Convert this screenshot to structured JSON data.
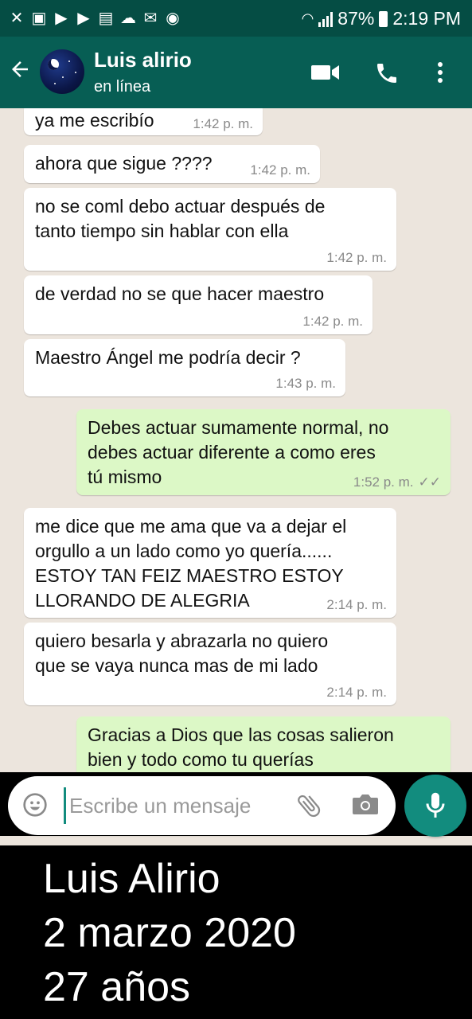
{
  "status_bar": {
    "battery": "87%",
    "time": "2:19 PM"
  },
  "header": {
    "contact_name": "Luis alirio",
    "contact_status": "en línea"
  },
  "messages": [
    {
      "text": "ya me escribío",
      "time": "1:42 p. m.",
      "direction": "in"
    },
    {
      "text": "ahora que sigue ????",
      "time": "1:42 p. m.",
      "direction": "in"
    },
    {
      "text": "no se coml debo actuar después de\ntanto tiempo sin hablar con ella",
      "time": "1:42 p. m.",
      "direction": "in"
    },
    {
      "text": "de verdad no se que hacer maestro",
      "time": "1:42 p. m.",
      "direction": "in"
    },
    {
      "text": "Maestro Ángel me podría decir ?",
      "time": "1:43 p. m.",
      "direction": "in"
    },
    {
      "text": "Debes actuar sumamente normal, no\ndebes actuar diferente a como eres\ntú mismo",
      "time": "1:52 p. m.",
      "direction": "out"
    },
    {
      "text": "me dice que me ama que va a dejar el\norgullo a un lado como yo quería......\nESTOY TAN FEIZ MAESTRO ESTOY\nLLORANDO DE ALEGRIA",
      "time": "2:14 p. m.",
      "direction": "in"
    },
    {
      "text": "quiero besarla y abrazarla no quiero\nque se vaya nunca mas de mi lado",
      "time": "2:14 p. m.",
      "direction": "in"
    },
    {
      "text": "Gracias a Dios que las cosas salieron\nbien y todo como tu querías",
      "time": "",
      "direction": "out"
    }
  ],
  "composer": {
    "placeholder": "Escribe un mensaje"
  },
  "caption": {
    "line1": "Luis Alirio",
    "line2": "2 marzo 2020",
    "line3": "27 años"
  },
  "colors": {
    "header": "#075e54",
    "status_bar": "#054d44",
    "outgoing_bubble": "#dcf8c6",
    "incoming_bubble": "#ffffff",
    "chat_background": "#ece5dd",
    "accent": "#128c7e"
  },
  "icons": [
    "back-arrow-icon",
    "video-call-icon",
    "phone-icon",
    "more-options-icon",
    "emoji-icon",
    "attach-icon",
    "camera-icon",
    "mic-icon"
  ]
}
